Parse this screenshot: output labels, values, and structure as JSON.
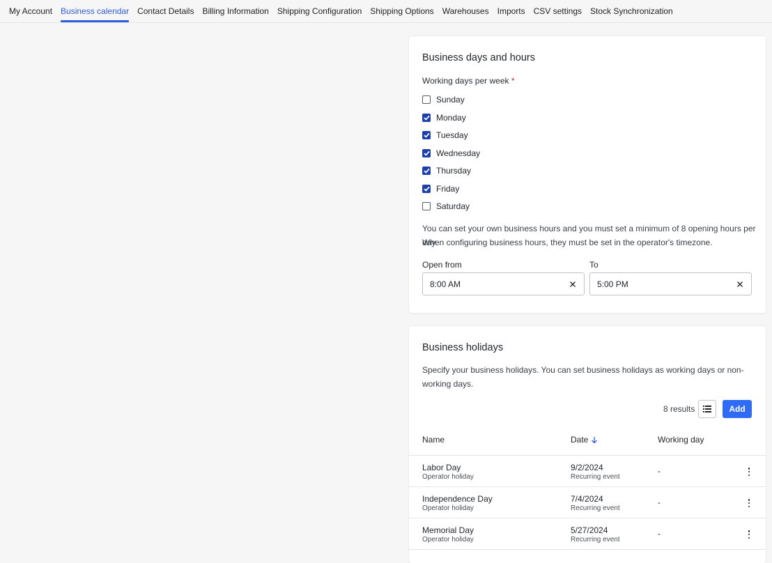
{
  "nav": {
    "tabs": [
      {
        "label": "My Account"
      },
      {
        "label": "Business calendar",
        "active": true
      },
      {
        "label": "Contact Details"
      },
      {
        "label": "Billing Information"
      },
      {
        "label": "Shipping Configuration"
      },
      {
        "label": "Shipping Options"
      },
      {
        "label": "Warehouses"
      },
      {
        "label": "Imports"
      },
      {
        "label": "CSV settings"
      },
      {
        "label": "Stock Synchronization"
      }
    ]
  },
  "business_hours": {
    "title": "Business days and hours",
    "days_label": "Working days per week",
    "required_mark": "*",
    "days": [
      {
        "label": "Sunday",
        "checked": false
      },
      {
        "label": "Monday",
        "checked": true
      },
      {
        "label": "Tuesday",
        "checked": true
      },
      {
        "label": "Wednesday",
        "checked": true
      },
      {
        "label": "Thursday",
        "checked": true
      },
      {
        "label": "Friday",
        "checked": true
      },
      {
        "label": "Saturday",
        "checked": false
      }
    ],
    "help_line1": "You can set your own business hours and you must set a minimum of 8 opening hours per day.",
    "help_line2": "When configuring business hours, they must be set in the operator's timezone.",
    "open_from_label": "Open from",
    "open_from_value": "8:00 AM",
    "to_label": "To",
    "to_value": "5:00 PM"
  },
  "holidays": {
    "title": "Business holidays",
    "description": "Specify your business holidays. You can set business holidays as working days or non-working days.",
    "results": "8 results",
    "add_label": "Add",
    "columns": {
      "name": "Name",
      "date": "Date",
      "working_day": "Working day"
    },
    "rows": [
      {
        "name": "Labor Day",
        "type": "Operator holiday",
        "date": "9/2/2024",
        "recurrence": "Recurring event",
        "working_day": "-"
      },
      {
        "name": "Independence Day",
        "type": "Operator holiday",
        "date": "7/4/2024",
        "recurrence": "Recurring event",
        "working_day": "-"
      },
      {
        "name": "Memorial Day",
        "type": "Operator holiday",
        "date": "5/27/2024",
        "recurrence": "Recurring event",
        "working_day": "-"
      }
    ]
  },
  "colors": {
    "accent": "#2e5bdc",
    "checkbox": "#1c3faa",
    "primary_button": "#2f6cf6",
    "required": "#d3262a"
  }
}
